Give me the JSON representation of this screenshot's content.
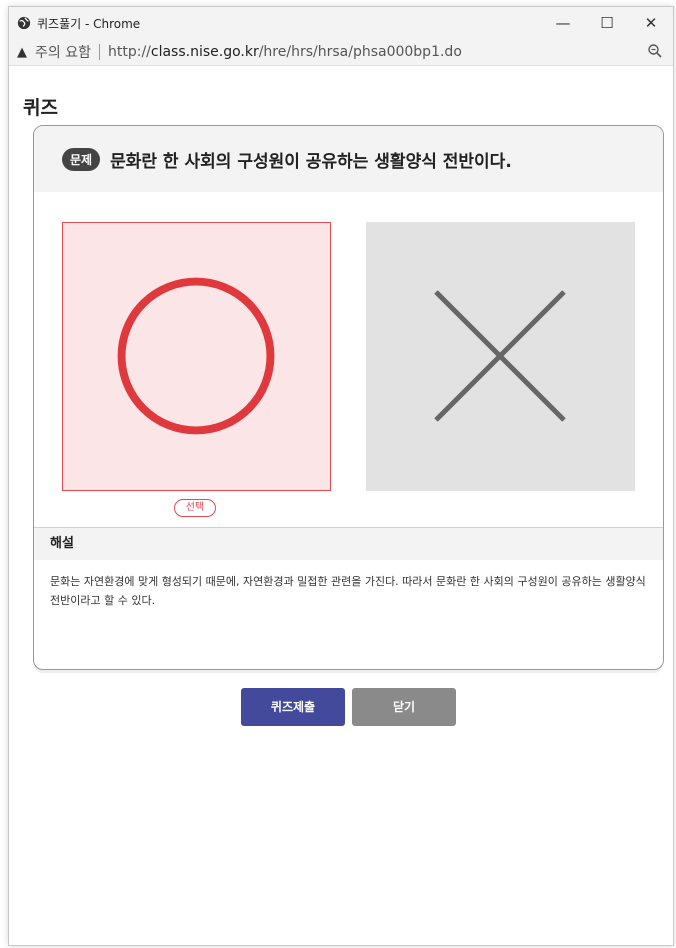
{
  "window": {
    "title": "퀴즈풀기 - Chrome",
    "controls": {
      "minimize": "—",
      "maximize": "☐",
      "close": "✕"
    }
  },
  "address_bar": {
    "warning_icon": "warning-icon",
    "warning_text": "주의 요함",
    "url_prefix": "http://",
    "url_host": "class.nise.go.kr",
    "url_path": "/hre/hrs/hrsa/phsa000bp1.do"
  },
  "page": {
    "title": "퀴즈"
  },
  "question": {
    "badge": "문제",
    "text": "문화란 한 사회의 구성원이 공유하는 생활양식 전반이다."
  },
  "options": [
    {
      "name": "o-option",
      "icon": "circle-o-icon",
      "selected": true
    },
    {
      "name": "x-option",
      "icon": "x-mark-icon",
      "selected": false
    }
  ],
  "selected_label": "선택",
  "explanation": {
    "heading": "해설",
    "text": "문화는 자연환경에 맞게 형성되기 때문에, 자연환경과 밀접한 관련을 가진다. 따라서 문화란 한 사회의 구성원이 공유하는 생활양식 전반이라고 할 수 있다."
  },
  "buttons": {
    "submit": "퀴즈제출",
    "close": "닫기"
  },
  "colors": {
    "selected_accent": "#e14a4f",
    "selected_bg": "#fbe5e6",
    "submit_button": "#434a9c",
    "close_button": "#8a8a8a",
    "x_mark": "#666666"
  }
}
